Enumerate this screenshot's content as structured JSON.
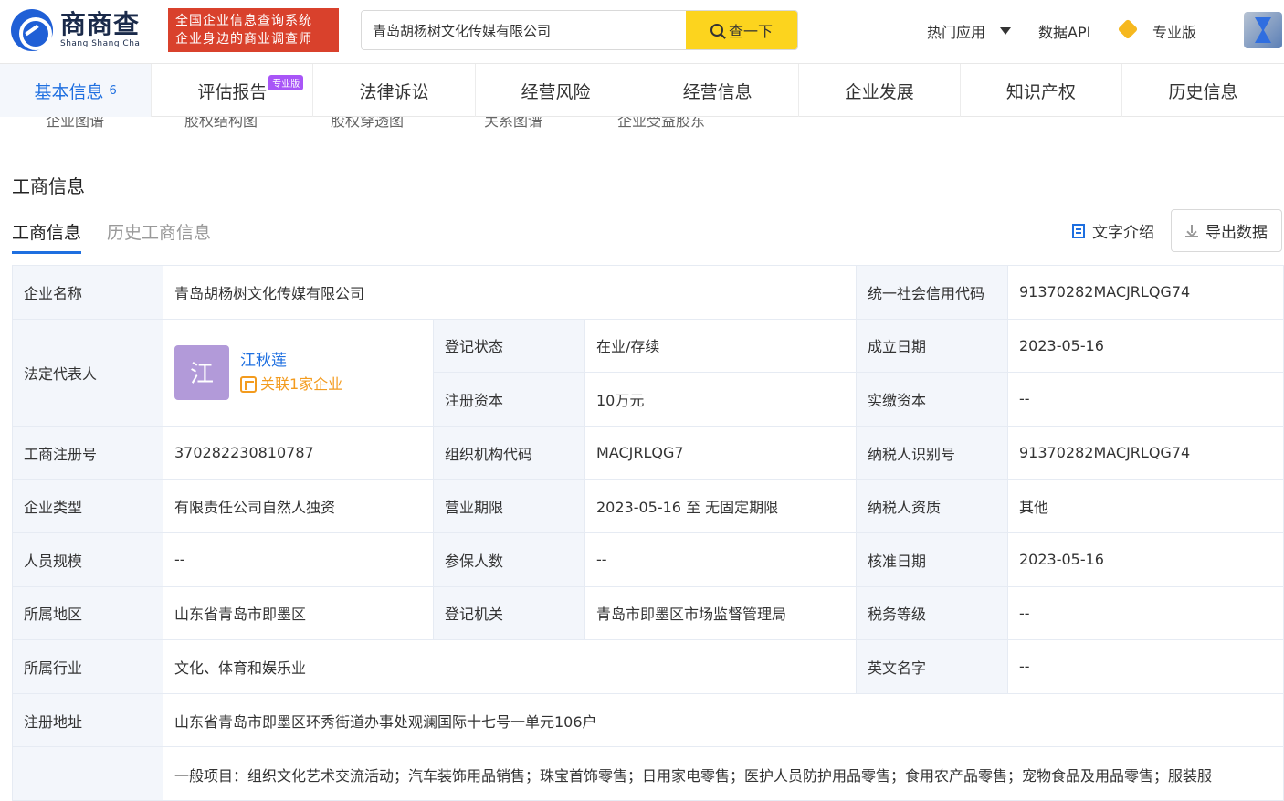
{
  "header": {
    "logo_cn": "商商查",
    "logo_en": "Shang Shang Cha",
    "slogan_line1": "全国企业信息查询系统",
    "slogan_line2": "企业身边的商业调查师",
    "search_value": "青岛胡杨树文化传媒有限公司",
    "search_button": "查一下",
    "nav_hot": "热门应用",
    "nav_api": "数据API",
    "nav_pro": "专业版"
  },
  "tabs": [
    {
      "label": "基本信息",
      "count": "6"
    },
    {
      "label": "评估报告",
      "badge": "专业版"
    },
    {
      "label": "法律诉讼"
    },
    {
      "label": "经营风险"
    },
    {
      "label": "经营信息"
    },
    {
      "label": "企业发展"
    },
    {
      "label": "知识产权"
    },
    {
      "label": "历史信息"
    }
  ],
  "sublinks": [
    "企业图谱",
    "股权结构图",
    "股权穿透图",
    "关系图谱",
    "企业受益股东"
  ],
  "section_title": "工商信息",
  "subtabs": [
    "工商信息",
    "历史工商信息"
  ],
  "actions": {
    "text_intro": "文字介绍",
    "export": "导出数据"
  },
  "rows": {
    "company_name_label": "企业名称",
    "company_name": "青岛胡杨树文化传媒有限公司",
    "credit_code_label": "统一社会信用代码",
    "credit_code": "91370282MACJRLQG74",
    "legal_rep_label": "法定代表人",
    "legal_rep_avatar": "江",
    "legal_rep_name": "江秋莲",
    "legal_rep_related": "关联1家企业",
    "reg_status_label": "登记状态",
    "reg_status": "在业/存续",
    "found_date_label": "成立日期",
    "found_date": "2023-05-16",
    "reg_capital_label": "注册资本",
    "reg_capital": "10万元",
    "paid_capital_label": "实缴资本",
    "paid_capital": "--",
    "reg_no_label": "工商注册号",
    "reg_no": "370282230810787",
    "org_code_label": "组织机构代码",
    "org_code": "MACJRLQG7",
    "taxpayer_id_label": "纳税人识别号",
    "taxpayer_id": "91370282MACJRLQG74",
    "company_type_label": "企业类型",
    "company_type": "有限责任公司自然人独资",
    "business_term_label": "营业期限",
    "business_term": "2023-05-16 至 无固定期限",
    "taxpayer_qual_label": "纳税人资质",
    "taxpayer_qual": "其他",
    "staff_size_label": "人员规模",
    "staff_size": "--",
    "insured_label": "参保人数",
    "insured": "--",
    "approve_date_label": "核准日期",
    "approve_date": "2023-05-16",
    "region_label": "所属地区",
    "region": "山东省青岛市即墨区",
    "reg_authority_label": "登记机关",
    "reg_authority": "青岛市即墨区市场监督管理局",
    "tax_grade_label": "税务等级",
    "tax_grade": "--",
    "industry_label": "所属行业",
    "industry": "文化、体育和娱乐业",
    "english_name_label": "英文名字",
    "english_name": "--",
    "address_label": "注册地址",
    "address": "山东省青岛市即墨区环秀街道办事处观澜国际十七号一单元106户",
    "scope_partial": "一般项目：组织文化艺术交流活动；汽车装饰用品销售；珠宝首饰零售；日用家电零售；医护人员防护用品零售；食用农产品零售；宠物食品及用品零售；服装服"
  }
}
